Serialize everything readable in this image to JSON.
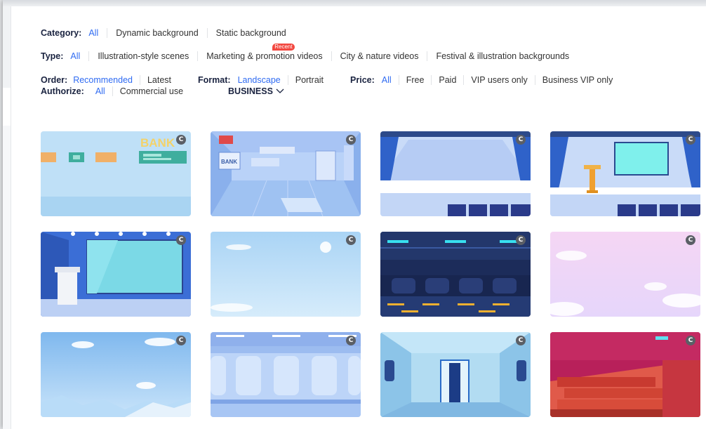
{
  "category": {
    "label": "Category:",
    "options": [
      "All",
      "Dynamic background",
      "Static background"
    ],
    "active": "All"
  },
  "type": {
    "label": "Type:",
    "options": [
      "All",
      "Illustration-style scenes",
      "Marketing & promotion videos",
      "City & nature videos",
      "Festival & illustration backgrounds"
    ],
    "active": "All",
    "recent_badge": "Recent"
  },
  "order": {
    "label": "Order:",
    "options": [
      "Recommended",
      "Latest"
    ],
    "active": "Recommended"
  },
  "format": {
    "label": "Format:",
    "options": [
      "Landscape",
      "Portrait"
    ],
    "active": "Landscape"
  },
  "price": {
    "label": "Price:",
    "options": [
      "All",
      "Free",
      "Paid",
      "VIP users only",
      "Business VIP only"
    ],
    "active": "All"
  },
  "authorize": {
    "label": "Authorize:",
    "options": [
      "All",
      "Commercial use"
    ],
    "active": "All",
    "business_label": "BUSINESS",
    "business_icon": "chevron-down-icon"
  },
  "card_badge": "C",
  "cards": [
    {
      "scene": "bank-counter",
      "icon": "copyright-icon",
      "sign_text": "BANK"
    },
    {
      "scene": "bank-hall",
      "icon": "copyright-icon",
      "sign_text": "BANK"
    },
    {
      "scene": "stage-curtains",
      "icon": "copyright-icon"
    },
    {
      "scene": "stage-podium-screen",
      "icon": "copyright-icon"
    },
    {
      "scene": "conference-screen",
      "icon": "copyright-icon"
    },
    {
      "scene": "blue-sky",
      "icon": "copyright-icon"
    },
    {
      "scene": "parking-garage",
      "icon": "copyright-icon"
    },
    {
      "scene": "pink-sky",
      "icon": "copyright-icon"
    },
    {
      "scene": "sky-mountains",
      "icon": "copyright-icon"
    },
    {
      "scene": "train-interior",
      "icon": "copyright-icon"
    },
    {
      "scene": "spaceship-corridor",
      "icon": "copyright-icon"
    },
    {
      "scene": "cinema-seats",
      "icon": "copyright-icon"
    }
  ],
  "colors": {
    "accent": "#2f6bf2",
    "badge_red": "#f2473f"
  }
}
